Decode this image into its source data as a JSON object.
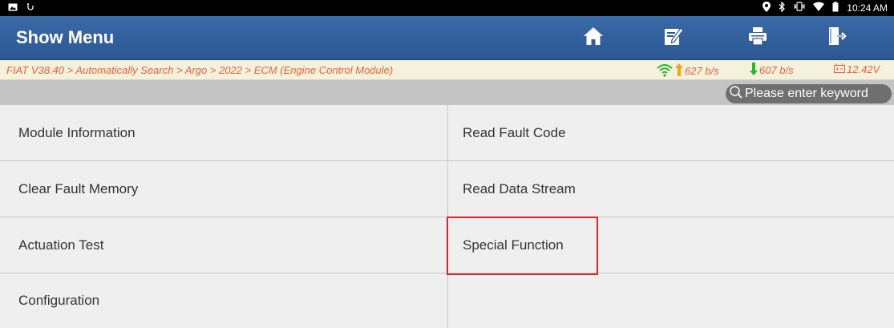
{
  "status_bar": {
    "time": "10:24 AM",
    "left_icons": [
      "image-icon",
      "usb-debug-icon"
    ],
    "right_icons": [
      "location-icon",
      "bluetooth-icon",
      "vibrate-icon",
      "wifi-icon",
      "battery-icon"
    ]
  },
  "header": {
    "title": "Show Menu",
    "buttons": [
      "home-button",
      "edit-button",
      "print-button",
      "exit-button"
    ]
  },
  "breadcrumb": {
    "path": "FIAT V38.40 > Automatically Search > Argo > 2022 > ECM (Engine Control Module)",
    "upload_speed": "627 b/s",
    "download_speed": "607 b/s",
    "voltage": "12.42V"
  },
  "search": {
    "placeholder": "Please enter keyword"
  },
  "menu": {
    "items": [
      {
        "label": "Module Information"
      },
      {
        "label": "Read Fault Code"
      },
      {
        "label": "Clear Fault Memory"
      },
      {
        "label": "Read Data Stream"
      },
      {
        "label": "Actuation Test"
      },
      {
        "label": "Special Function"
      },
      {
        "label": "Configuration"
      }
    ]
  },
  "colors": {
    "header_bg": "#2c5893",
    "breadcrumb_text": "#e8623a",
    "highlight": "#e0202a"
  }
}
